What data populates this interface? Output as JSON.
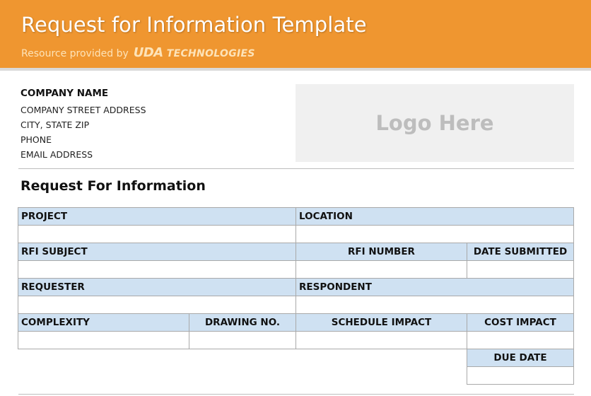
{
  "header": {
    "title": "Request for Information Template",
    "subtitle_prefix": "Resource provided by",
    "brand_mark": "UDA",
    "brand_word": "TECHNOLOGIES"
  },
  "company": {
    "name": "COMPANY NAME",
    "street": "COMPANY STREET ADDRESS",
    "city": "CITY, STATE ZIP",
    "phone": "PHONE",
    "email": "EMAIL ADDRESS"
  },
  "logo": {
    "placeholder": "Logo Here"
  },
  "form": {
    "title": "Request For Information",
    "labels": {
      "project": "PROJECT",
      "location": "LOCATION",
      "rfi_subject": "RFI SUBJECT",
      "rfi_number": "RFI NUMBER",
      "date_submitted": "DATE SUBMITTED",
      "requester": "REQUESTER",
      "respondent": "RESPONDENT",
      "complexity": "COMPLEXITY",
      "drawing_no": "DRAWING NO.",
      "schedule_impact": "SCHEDULE IMPACT",
      "cost_impact": "COST IMPACT",
      "due_date": "DUE DATE"
    },
    "values": {
      "project": "",
      "location": "",
      "rfi_subject": "",
      "rfi_number": "",
      "date_submitted": "",
      "requester": "",
      "respondent": "",
      "complexity": "",
      "drawing_no": "",
      "schedule_impact": "",
      "cost_impact": "",
      "due_date": ""
    }
  },
  "colors": {
    "banner": "#ef9630",
    "header_cell": "#cfe1f2",
    "logo_box": "#f0f0f0"
  }
}
